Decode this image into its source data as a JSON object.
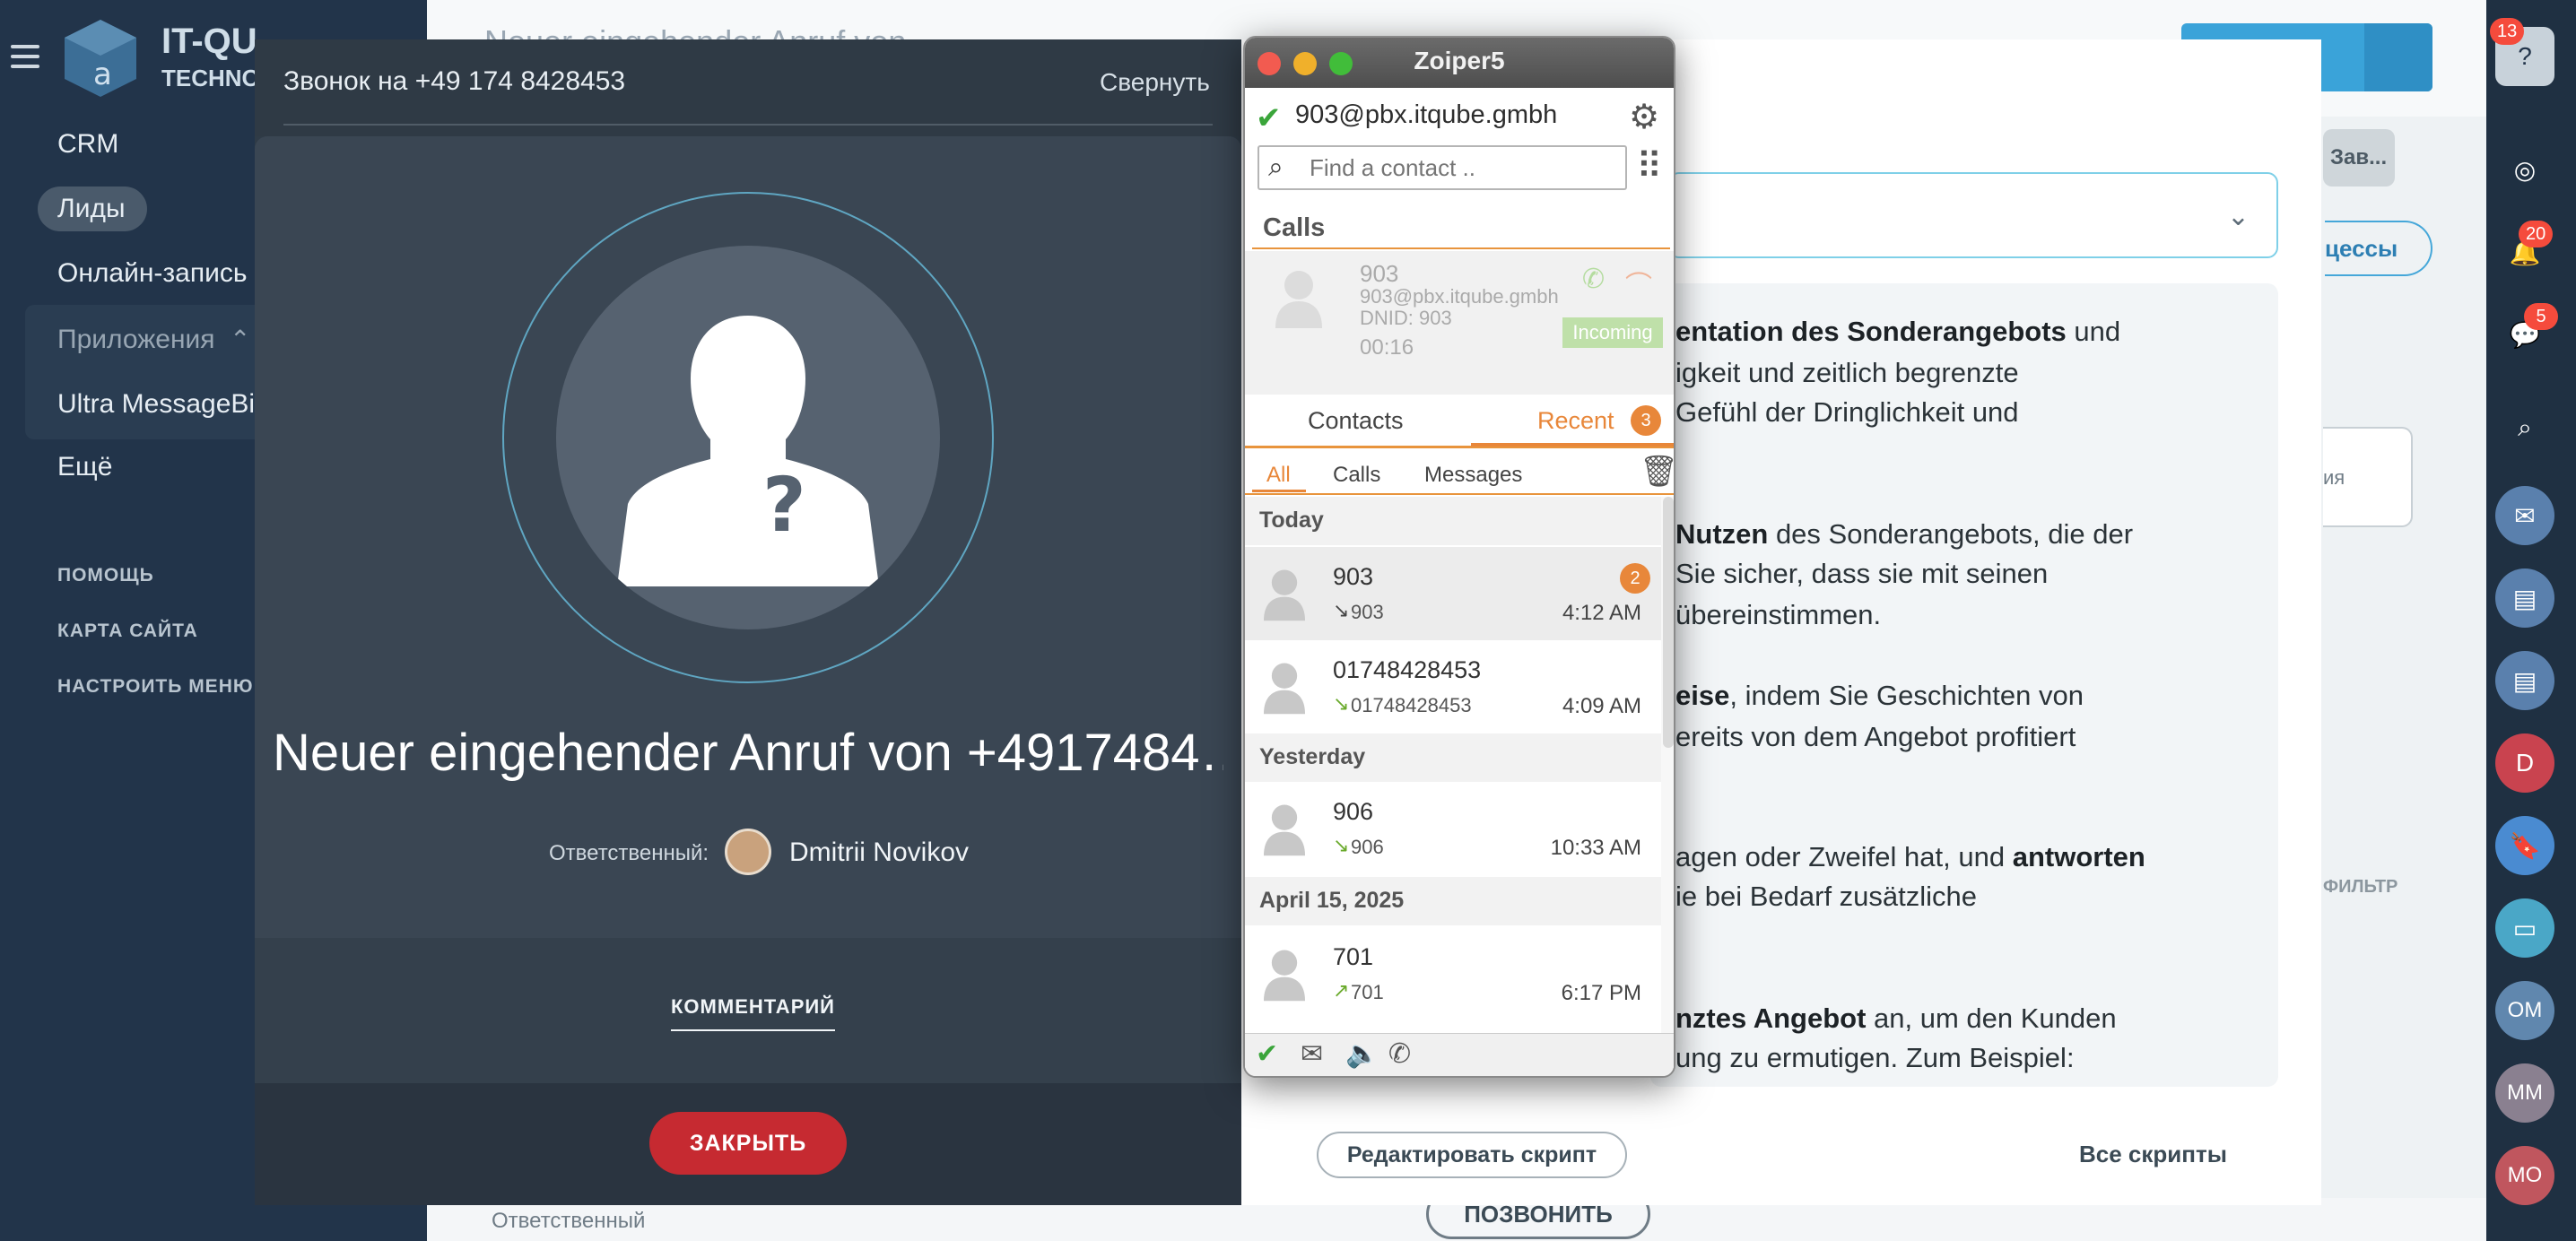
{
  "crm": {
    "sidebar": {
      "logo_text": "IT-QU",
      "logo_sub": "TECHNO",
      "items": [
        "CRM",
        "Лиды",
        "Онлайн-запись",
        "Приложения",
        "Ultra MessageBi",
        "Ещё"
      ],
      "bottom_links": [
        "ПОМОЩЬ",
        "КАРТА САЙТА",
        "НАСТРОИТЬ МЕНЮ"
      ]
    },
    "page_title": "Neuer eingehender Anruf von",
    "call_button": "ПОЗВОНИТЬ",
    "responsible_label": "Ответственный",
    "stage_chip": "Зав...",
    "processes_chip": "цессы",
    "filter_chip": "ФИЛЬТР",
    "widget_text": "ия"
  },
  "rail": {
    "help_badge": "13",
    "notifications_badge": "20",
    "chat_badge": "5",
    "avatars": [
      "D",
      "OM",
      "MM",
      "MO"
    ]
  },
  "call_popup": {
    "title": "Звонок на +49 174 8428453",
    "collapse": "Свернуть",
    "caller_line": "Neuer eingehender Anruf von +4917484…",
    "responsible_label": "Ответственный:",
    "responsible_name": "Dmitrii Novikov",
    "comment_tab": "КОММЕНТАРИЙ",
    "close_button": "ЗАКРЫТЬ"
  },
  "script_panel": {
    "lines": [
      [
        "entation des Sonderangebots",
        " und"
      ],
      [
        "",
        "igkeit und zeitlich begrenzte"
      ],
      [
        "",
        "Gefühl der Dringlichkeit und"
      ],
      [
        "",
        ""
      ],
      [
        " Nutzen",
        " des Sonderangebots, die der"
      ],
      [
        "",
        "Sie sicher, dass sie mit seinen"
      ],
      [
        "",
        " übereinstimmen."
      ],
      [
        "eise",
        ", indem Sie Geschichten von"
      ],
      [
        "",
        "ereits von dem Angebot profitiert"
      ],
      [
        "",
        "agen oder Zweifel hat, und "
      ],
      [
        "",
        "ie bei Bedarf zusätzliche"
      ],
      [
        "nztes Angebot",
        " an, um den Kunden"
      ],
      [
        "",
        "ung zu ermutigen. Zum Beispiel:"
      ]
    ],
    "line_answer": "antworten",
    "edit_button": "Редактировать скрипт",
    "all_scripts": "Все скрипты"
  },
  "zoiper": {
    "window_title": "Zoiper5",
    "account": "903@pbx.itqube.gmbh",
    "search_placeholder": "Find a contact ..",
    "calls_header": "Calls",
    "active_call": {
      "number": "903",
      "uri": "903@pbx.itqube.gmbh",
      "dnid": "DNID: 903",
      "duration": "00:16",
      "status": "Incoming"
    },
    "tabs": {
      "contacts": "Contacts",
      "recent": "Recent",
      "recent_count": "3"
    },
    "filters": {
      "all": "All",
      "calls": "Calls",
      "messages": "Messages"
    },
    "days": [
      "Today",
      "Yesterday",
      "April 15, 2025"
    ],
    "entries": [
      {
        "name": "903",
        "sub": "903",
        "time": "4:12 AM",
        "count": "2",
        "dir": "↘"
      },
      {
        "name": "01748428453",
        "sub": "01748428453",
        "time": "4:09 AM",
        "dir": "↘"
      },
      {
        "name": "906",
        "sub": "906",
        "time": "10:33 AM",
        "dir": "↘"
      },
      {
        "name": "701",
        "sub": "701",
        "time": "6:17 PM",
        "dir": "↗"
      }
    ],
    "colors": {
      "accent": "#e8873a",
      "online": "#3aa53a"
    }
  }
}
